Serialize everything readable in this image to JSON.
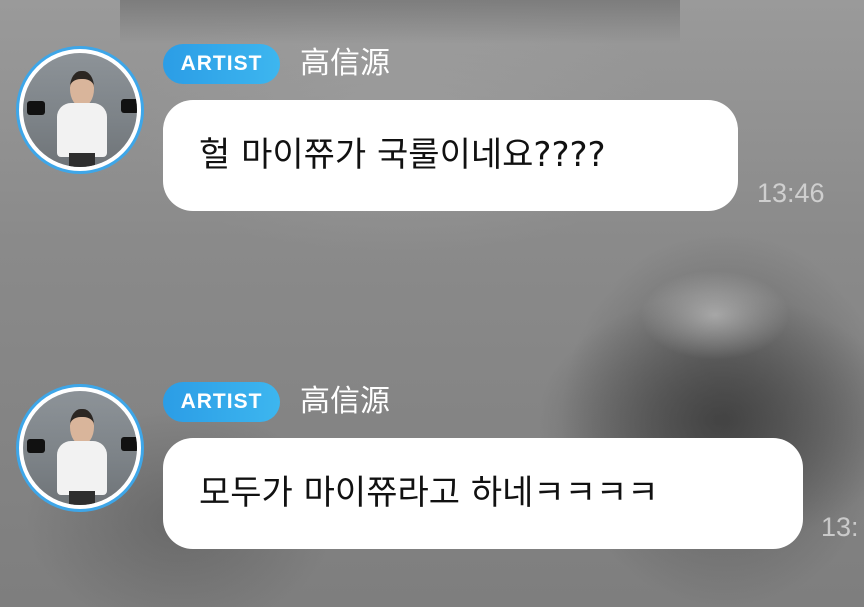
{
  "messages": [
    {
      "badge": "ARTIST",
      "sender": "高信源",
      "text": "헐 마이쮸가 국룰이네요????",
      "time": "13:46"
    },
    {
      "badge": "ARTIST",
      "sender": "高信源",
      "text": "모두가 마이쮸라고 하네ㅋㅋㅋㅋ",
      "time": "13:"
    }
  ],
  "colors": {
    "badge_blue": "#2b9de6",
    "avatar_ring": "#3ea6e8",
    "bubble_bg": "#ffffff"
  },
  "icons": {
    "avatar": "artist-avatar-photo"
  }
}
